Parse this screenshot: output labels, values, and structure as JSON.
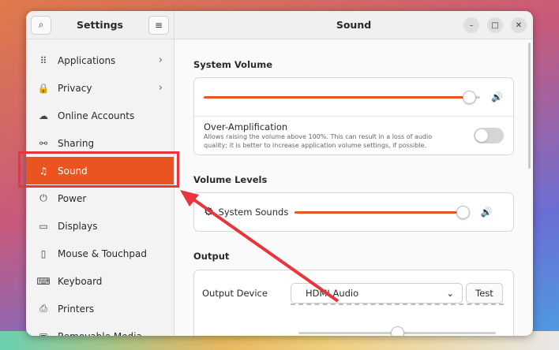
{
  "sidebar": {
    "title": "Settings",
    "items": [
      {
        "label": "Applications",
        "icon": "grid-icon",
        "glyph": "⠿",
        "chevron": true
      },
      {
        "label": "Privacy",
        "icon": "lock-icon",
        "glyph": "🔒",
        "chevron": true
      },
      {
        "label": "Online Accounts",
        "icon": "cloud-icon",
        "glyph": "☁",
        "chevron": false
      },
      {
        "label": "Sharing",
        "icon": "share-icon",
        "glyph": "⚯",
        "chevron": false
      },
      {
        "label": "Sound",
        "icon": "music-note-icon",
        "glyph": "♫",
        "chevron": false,
        "active": true
      },
      {
        "label": "Power",
        "icon": "power-icon",
        "glyph": "⏻",
        "chevron": false
      },
      {
        "label": "Displays",
        "icon": "display-icon",
        "glyph": "▭",
        "chevron": false
      },
      {
        "label": "Mouse & Touchpad",
        "icon": "mouse-icon",
        "glyph": "▯",
        "chevron": false
      },
      {
        "label": "Keyboard",
        "icon": "keyboard-icon",
        "glyph": "⌨",
        "chevron": false
      },
      {
        "label": "Printers",
        "icon": "printer-icon",
        "glyph": "⎙",
        "chevron": false
      },
      {
        "label": "Removable Media",
        "icon": "media-icon",
        "glyph": "▣",
        "chevron": false
      }
    ]
  },
  "content": {
    "title": "Sound",
    "system_volume": {
      "heading": "System Volume",
      "level": 0.96,
      "over_amp_title": "Over-Amplification",
      "over_amp_desc_line1": "Allows raising the volume above 100%. This can result in a loss of audio",
      "over_amp_desc_line2": "quality; it is better to increase application volume settings, if possible.",
      "over_amp_enabled": false
    },
    "volume_levels": {
      "heading": "Volume Levels",
      "system_sounds_label": "System Sounds",
      "level": 0.96
    },
    "output": {
      "heading": "Output",
      "device_label": "Output Device",
      "device_value": "HDMI Audio",
      "test_label": "Test"
    }
  },
  "colors": {
    "accent": "#e95420",
    "annotation": "#e8343a"
  }
}
